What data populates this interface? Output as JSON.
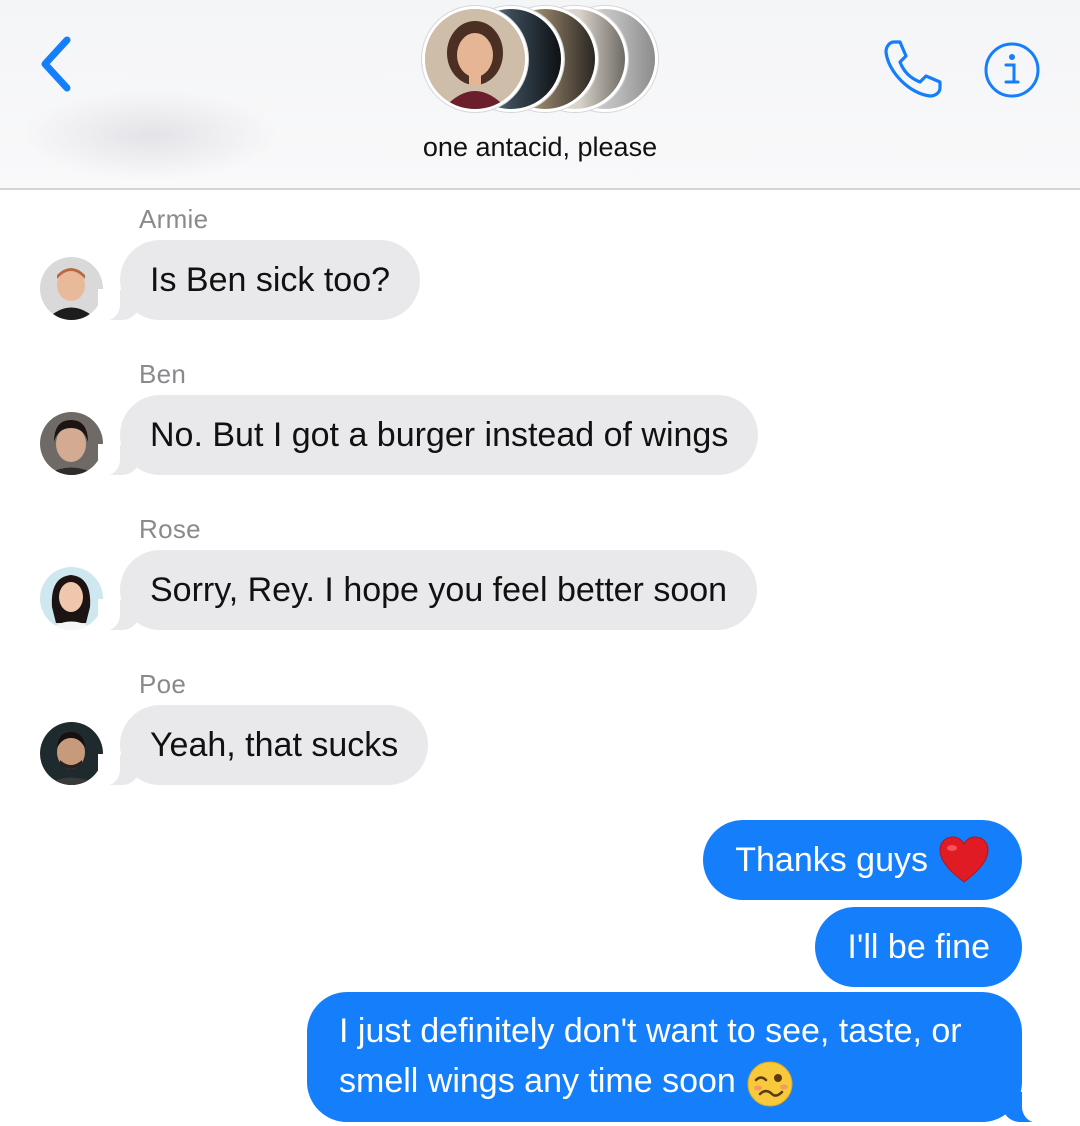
{
  "header": {
    "title": "one antacid, please",
    "accent_color": "#147efb",
    "icons": {
      "back": "chevron-left-icon",
      "call": "phone-icon",
      "info": "info-icon"
    },
    "group_avatar_count": 5
  },
  "messages": [
    {
      "sender": "Armie",
      "text": "Is Ben sick too?",
      "direction": "incoming"
    },
    {
      "sender": "Ben",
      "text": "No. But I got a burger instead of wings",
      "direction": "incoming"
    },
    {
      "sender": "Rose",
      "text": "Sorry, Rey. I hope you feel better soon",
      "direction": "incoming"
    },
    {
      "sender": "Poe",
      "text": "Yeah, that sucks",
      "direction": "incoming"
    },
    {
      "text": "Thanks guys",
      "emoji": "red-heart-icon",
      "direction": "outgoing"
    },
    {
      "text": "I'll be fine",
      "direction": "outgoing"
    },
    {
      "text": "I just definitely don't want to see, taste, or smell wings any time soon",
      "emoji": "woozy-face-icon",
      "direction": "outgoing"
    }
  ],
  "colors": {
    "incoming_bubble": "#e9e9eb",
    "outgoing_bubble": "#147efb",
    "sender_label": "#8a8a8e"
  }
}
